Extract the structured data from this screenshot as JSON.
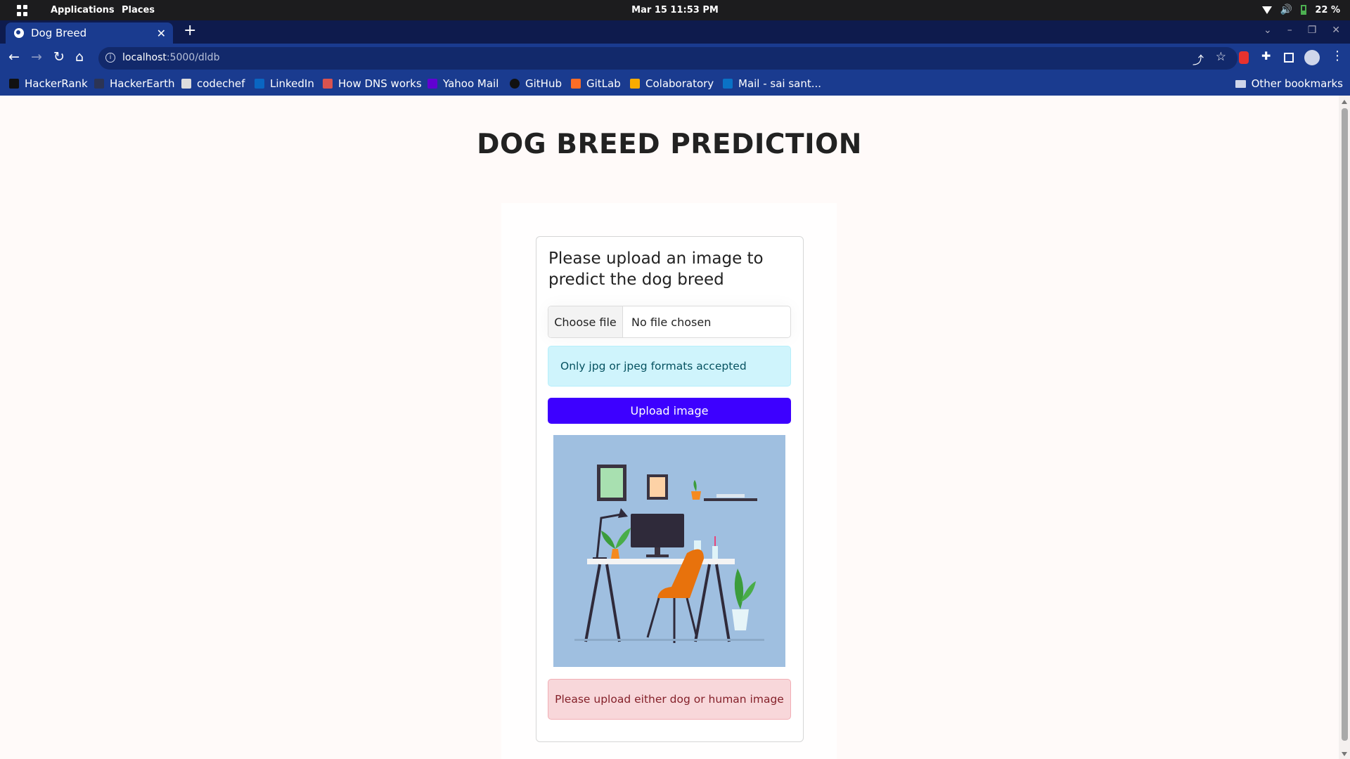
{
  "os_bar": {
    "menu_applications": "Applications",
    "menu_places": "Places",
    "clock": "Mar 15  11:53 PM",
    "battery": "22 %"
  },
  "browser": {
    "tab_title": "Dog Breed",
    "url_host": "localhost",
    "url_path": ":5000/dldb",
    "bookmarks": [
      {
        "label": "HackerRank",
        "icon": "hackerrank-icon",
        "color": "#111111"
      },
      {
        "label": "HackerEarth",
        "icon": "hackerearth-icon",
        "color": "#2c3454"
      },
      {
        "label": "codechef",
        "icon": "codechef-icon",
        "color": "#dddddd"
      },
      {
        "label": "LinkedIn",
        "icon": "linkedin-icon",
        "color": "#0a66c2"
      },
      {
        "label": "How DNS works",
        "icon": "dns-icon",
        "color": "#d9534f"
      },
      {
        "label": "Yahoo Mail",
        "icon": "yahoo-icon",
        "color": "#6001d2"
      },
      {
        "label": "GitHub",
        "icon": "github-icon",
        "color": "#111111"
      },
      {
        "label": "GitLab",
        "icon": "gitlab-icon",
        "color": "#fc6d26"
      },
      {
        "label": "Colaboratory",
        "icon": "colab-icon",
        "color": "#f9ab00"
      },
      {
        "label": "Mail - sai sant...",
        "icon": "outlook-icon",
        "color": "#0a72c6"
      }
    ],
    "other_bookmarks": "Other bookmarks"
  },
  "page": {
    "title": "DOG BREED PREDICTION",
    "card_title": "Please upload an image to predict the dog breed",
    "file_button": "Choose file",
    "file_status": "No file chosen",
    "info_message": "Only jpg or jpeg formats accepted",
    "upload_button": "Upload image",
    "error_message": "Please upload either dog or human image"
  },
  "colors": {
    "accent": "#3d00ff",
    "info_bg": "#cff4fc",
    "danger_bg": "#f8d7da",
    "browser_chrome": "#1a3b8f"
  }
}
